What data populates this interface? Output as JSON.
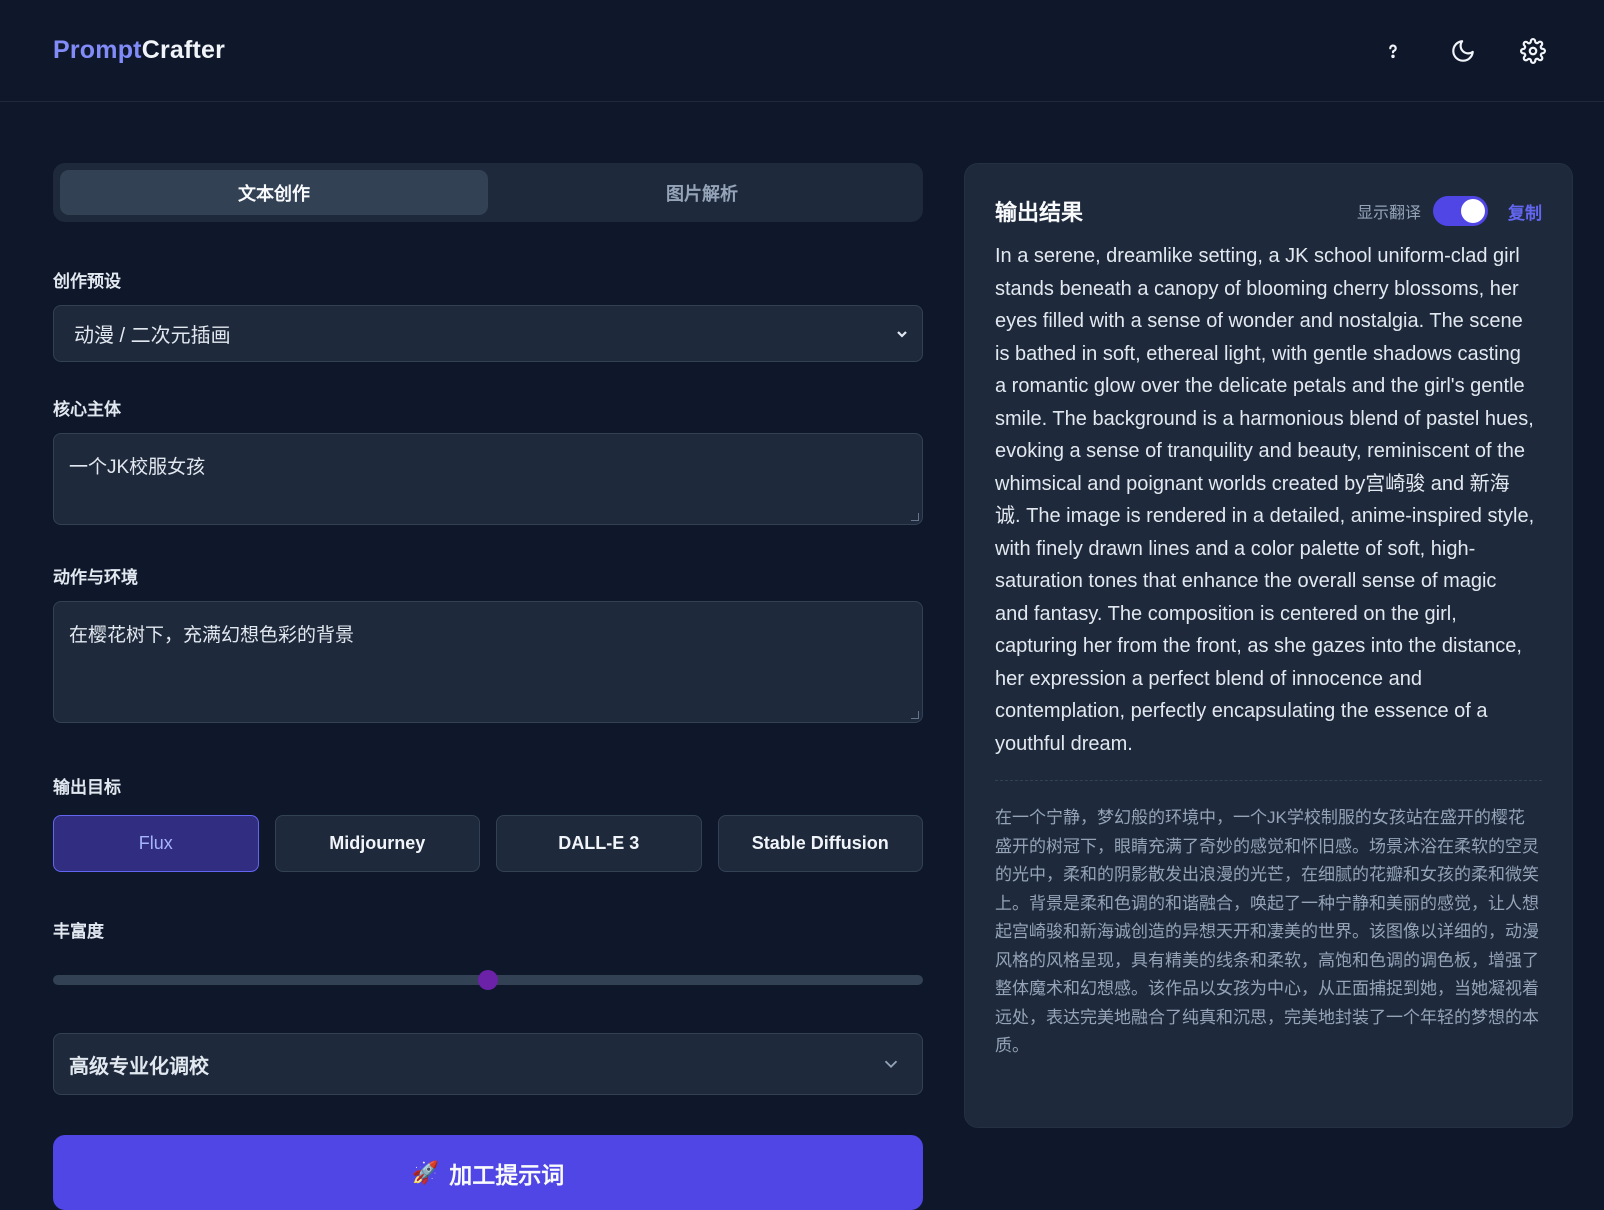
{
  "header": {
    "brand_part1": "Prompt",
    "brand_part2": "Crafter",
    "icons": [
      "help-icon",
      "moon-icon",
      "gear-icon"
    ]
  },
  "tabs": [
    {
      "label": "文本创作",
      "active": true
    },
    {
      "label": "图片解析",
      "active": false
    }
  ],
  "form": {
    "preset_label": "创作预设",
    "preset_value": "动漫 / 二次元插画",
    "subject_label": "核心主体",
    "subject_value": "一个JK校服女孩",
    "action_label": "动作与环境",
    "action_value": "在樱花树下，充满幻想色彩的背景",
    "target_label": "输出目标",
    "targets": [
      "Flux",
      "Midjourney",
      "DALL-E 3",
      "Stable Diffusion"
    ],
    "selected_target": "Flux",
    "richness_label": "丰富度",
    "richness_value": 0.5,
    "advanced_label": "高级专业化调校",
    "generate_icon": "🚀",
    "generate_label": "加工提示词"
  },
  "output": {
    "title": "输出结果",
    "translate_label": "显示翻译",
    "translate_on": true,
    "copy_label": "复制",
    "english": "In a serene, dreamlike setting, a JK school uniform-clad girl stands beneath a canopy of blooming cherry blossoms, her eyes filled with a sense of wonder and nostalgia. The scene is bathed in soft, ethereal light, with gentle shadows casting a romantic glow over the delicate petals and the girl's gentle smile. The background is a harmonious blend of pastel hues, evoking a sense of tranquility and beauty, reminiscent of the whimsical and poignant worlds created by宫崎骏 and 新海诚. The image is rendered in a detailed, anime-inspired style, with finely drawn lines and a color palette of soft, high-saturation tones that enhance the overall sense of magic and fantasy. The composition is centered on the girl, capturing her from the front, as she gazes into the distance, her expression a perfect blend of innocence and contemplation, perfectly encapsulating the essence of a youthful dream.",
    "chinese": "在一个宁静，梦幻般的环境中，一个JK学校制服的女孩站在盛开的樱花盛开的树冠下，眼睛充满了奇妙的感觉和怀旧感。场景沐浴在柔软的空灵的光中，柔和的阴影散发出浪漫的光芒，在细腻的花瓣和女孩的柔和微笑上。背景是柔和色调的和谐融合，唤起了一种宁静和美丽的感觉，让人想起宫崎骏和新海诚创造的异想天开和凄美的世界。该图像以详细的，动漫风格的风格呈现，具有精美的线条和柔软，高饱和色调的调色板，增强了整体魔术和幻想感。该作品以女孩为中心，从正面捕捉到她，当她凝视着远处，表达完美地融合了纯真和沉思，完美地封装了一个年轻的梦想的本质。"
  },
  "colors": {
    "background": "#0f172a",
    "panel": "#1e293b",
    "accent": "#4f46e5",
    "accent_text": "#6366f1",
    "slider_thumb": "#6b21a8"
  }
}
